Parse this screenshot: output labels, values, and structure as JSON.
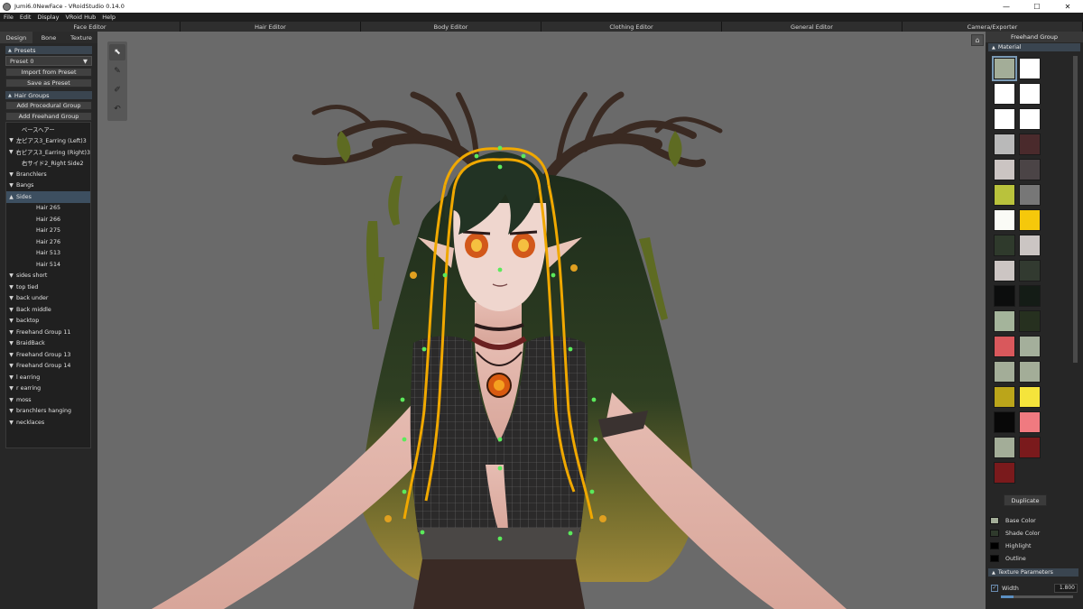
{
  "window": {
    "title": "Jumi6.0NewFace - VRoidStudio 0.14.0",
    "controls": {
      "minimize": "—",
      "maximize": "☐",
      "close": "✕"
    }
  },
  "menu": [
    "File",
    "Edit",
    "Display",
    "VRoid Hub",
    "Help"
  ],
  "editor_tabs": [
    "Face Editor",
    "Hair Editor",
    "Body Editor",
    "Clothing Editor",
    "General Editor",
    "Camera/Exporter"
  ],
  "left": {
    "tabs": [
      "Design",
      "Bone",
      "Texture"
    ],
    "presets": {
      "header": "Presets",
      "selected": "Preset 0",
      "import_label": "Import from Preset",
      "save_label": "Save as Preset"
    },
    "hair_groups": {
      "header": "Hair Groups",
      "add_procedural": "Add Procedural Group",
      "add_freehand": "Add Freehand Group",
      "items": [
        {
          "label": "ベースヘアー",
          "arrow": ""
        },
        {
          "label": "左ピアス3_Earring (Left)3",
          "arrow": "down"
        },
        {
          "label": "右ピアス3_Earring (Right)3",
          "arrow": "down"
        },
        {
          "label": "右サイド2_Right Side2",
          "arrow": ""
        },
        {
          "label": "Branchlers",
          "arrow": "down"
        },
        {
          "label": "Bangs",
          "arrow": "down"
        },
        {
          "label": "Sides",
          "arrow": "up",
          "selected": true
        },
        {
          "label": "Hair 265",
          "child": true
        },
        {
          "label": "Hair 266",
          "child": true
        },
        {
          "label": "Hair 275",
          "child": true
        },
        {
          "label": "Hair 276",
          "child": true
        },
        {
          "label": "Hair 513",
          "child": true
        },
        {
          "label": "Hair 514",
          "child": true
        },
        {
          "label": "sides short",
          "arrow": "down"
        },
        {
          "label": "top tied",
          "arrow": "down"
        },
        {
          "label": "back under",
          "arrow": "down"
        },
        {
          "label": "Back middle",
          "arrow": "down"
        },
        {
          "label": "backtop",
          "arrow": "down"
        },
        {
          "label": "Freehand Group 11",
          "arrow": "down"
        },
        {
          "label": "BraidBack",
          "arrow": "down"
        },
        {
          "label": "Freehand Group 13",
          "arrow": "down"
        },
        {
          "label": "Freehand Group 14",
          "arrow": "down"
        },
        {
          "label": "l earring",
          "arrow": "down"
        },
        {
          "label": "r earring",
          "arrow": "down"
        },
        {
          "label": "moss",
          "arrow": "down"
        },
        {
          "label": "branchlers hanging",
          "arrow": "down"
        },
        {
          "label": "necklaces",
          "arrow": "down"
        }
      ]
    }
  },
  "tools": [
    {
      "name": "select-tool-icon",
      "glyph": "⬉",
      "active": true
    },
    {
      "name": "brush-tool-icon",
      "glyph": "✎"
    },
    {
      "name": "eraser-tool-icon",
      "glyph": "✐"
    },
    {
      "name": "undo-tool-icon",
      "glyph": "↶"
    }
  ],
  "right": {
    "header": "Freehand Group",
    "material_header": "Material",
    "swatches": [
      "#a3ad98",
      "#ffffff",
      "#ffffff",
      "#ffffff",
      "#ffffff",
      "#ffffff",
      "#b9b9b9",
      "#4a2a2c",
      "#cbc4c2",
      "#4b4446",
      "#b9c23c",
      "#777777",
      "#fafbf6",
      "#f5c80b",
      "#2f3a2c",
      "#cbc5c3",
      "#ccc5c3",
      "#323a30",
      "#0c0d0d",
      "#141c16",
      "#a4b49b",
      "#26301f",
      "#d9585c",
      "#a4af9b",
      "#a3ad98",
      "#a3ad98",
      "#bba51a",
      "#f5e43b",
      "#080808",
      "#f07a80",
      "#a3ad98",
      "#7a1a1c",
      "#7a1a1c"
    ],
    "duplicate_label": "Duplicate",
    "colors": [
      {
        "label": "Base Color",
        "color": "#a3ad98"
      },
      {
        "label": "Shade Color",
        "color": "#2f3a2c"
      },
      {
        "label": "Highlight",
        "color": "#000000"
      },
      {
        "label": "Outline",
        "color": "#000000"
      }
    ],
    "texture_header": "Texture Parameters",
    "width": {
      "label": "Width",
      "value": "1.800",
      "fraction": 0.18
    }
  }
}
